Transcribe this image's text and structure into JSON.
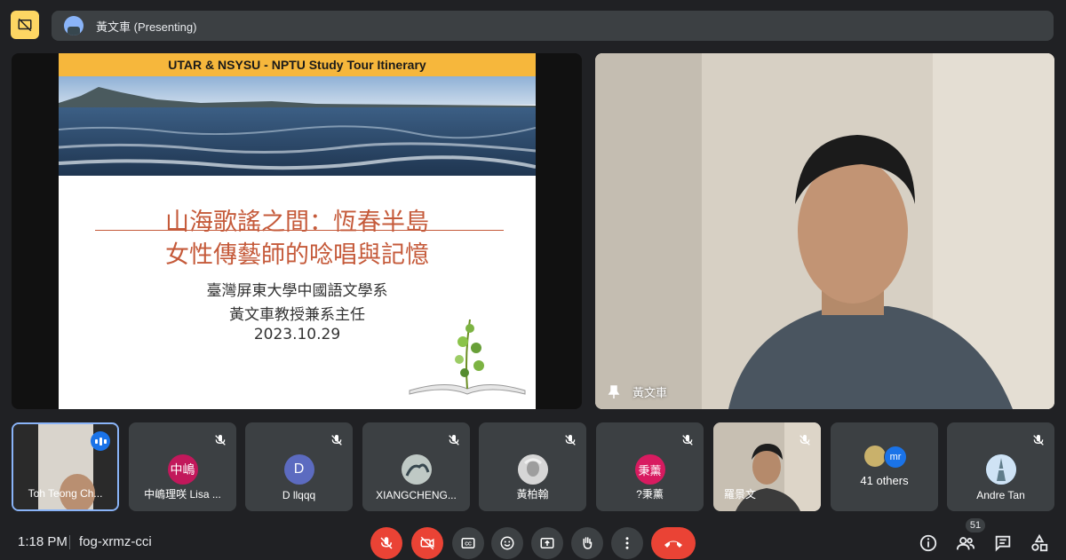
{
  "top_bar": {
    "presenting_label": "黃文車 (Presenting)"
  },
  "slide": {
    "header": "UTAR & NSYSU - NPTU Study Tour Itinerary",
    "title_line1": "山海歌謠之間：恆春半島",
    "title_line2": "女性傳藝師的唸唱與記憶",
    "subtitle1": "臺灣屏東大學中國語文學系",
    "subtitle2": "黃文車教授兼系主任",
    "date": "2023.10.29"
  },
  "speaker": {
    "name": "黃文車"
  },
  "participants": [
    {
      "label": "Toh Teong Ch...",
      "kind": "video"
    },
    {
      "label": "中嶋理咲 Lisa ...",
      "avatar_text": "中嶋",
      "avatar_color": "#c2185b"
    },
    {
      "label": "D llqqq",
      "avatar_text": "D",
      "avatar_color": "#5c6bc0"
    },
    {
      "label": "XIANGCHENG...",
      "avatar_text": "",
      "avatar_color": "#9e9e9e"
    },
    {
      "label": "黃柏翰",
      "avatar_text": "",
      "avatar_color": "#bdbdbd"
    },
    {
      "label": "?秉薰",
      "avatar_text": "秉薰",
      "avatar_color": "#d81b60"
    },
    {
      "label": "羅景文",
      "kind": "video"
    },
    {
      "label": "41 others",
      "avatar_text": "mr",
      "avatar_color": "#1a73e8"
    },
    {
      "label": "Andre Tan",
      "avatar_text": "",
      "avatar_color": "#90caf9"
    }
  ],
  "bottom_bar": {
    "time": "1:18 PM",
    "meeting_code": "fog-xrmz-cci",
    "participant_count": "51"
  }
}
